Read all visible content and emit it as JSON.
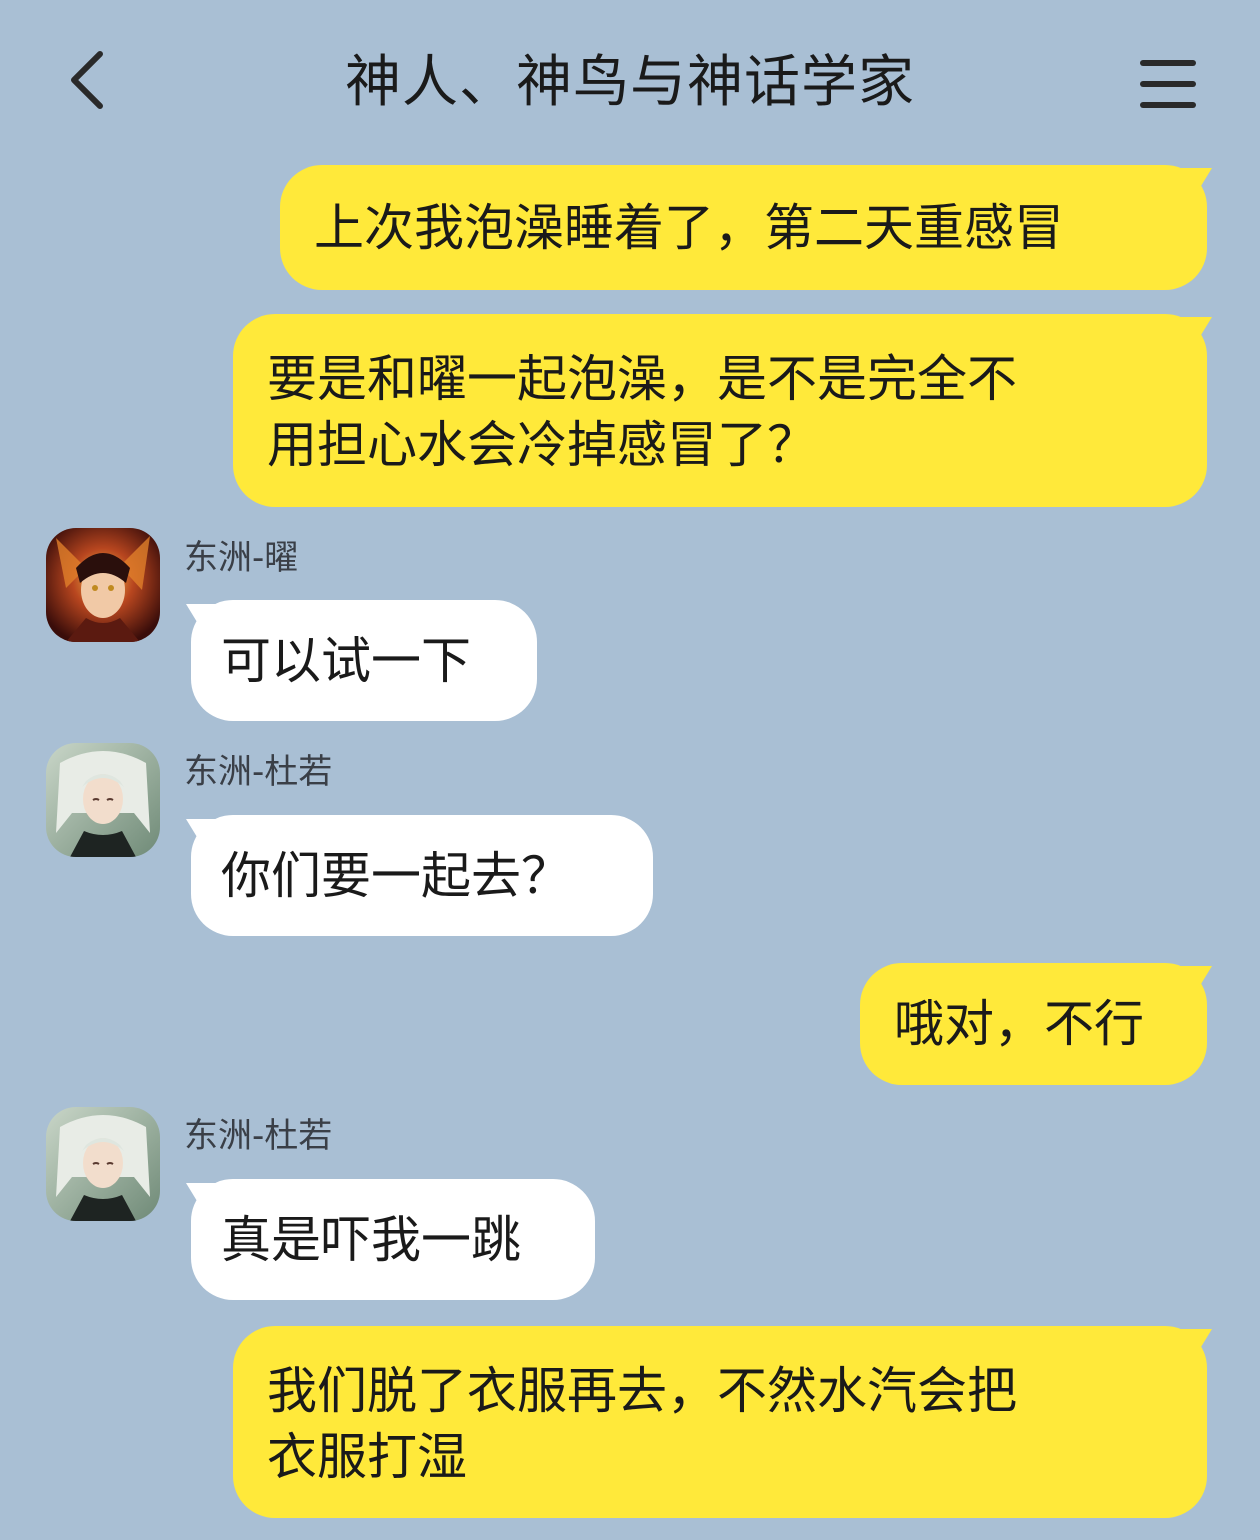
{
  "header": {
    "title": "神人、神鸟与神话学家",
    "back_icon": "chevron-left-icon",
    "menu_icon": "hamburger-menu-icon"
  },
  "colors": {
    "background": "#a9bfd4",
    "outgoing_bubble": "#ffe93a",
    "incoming_bubble": "#ffffff"
  },
  "messages": [
    {
      "direction": "outgoing",
      "lines": [
        "上次我泡澡睡着了，第二天重感冒"
      ]
    },
    {
      "direction": "outgoing",
      "lines": [
        "要是和曜一起泡澡，是不是完全不",
        "用担心水会冷掉感冒了？"
      ]
    },
    {
      "direction": "incoming",
      "sender": "东洲-曜",
      "lines": [
        "可以试一下"
      ]
    },
    {
      "direction": "incoming",
      "sender": "东洲-杜若",
      "lines": [
        "你们要一起去？"
      ]
    },
    {
      "direction": "outgoing",
      "lines": [
        "哦对，不行"
      ]
    },
    {
      "direction": "incoming",
      "sender": "东洲-杜若",
      "lines": [
        "真是吓我一跳"
      ]
    },
    {
      "direction": "outgoing",
      "lines": [
        "我们脱了衣服再去，不然水汽会把",
        "衣服打湿"
      ]
    }
  ]
}
